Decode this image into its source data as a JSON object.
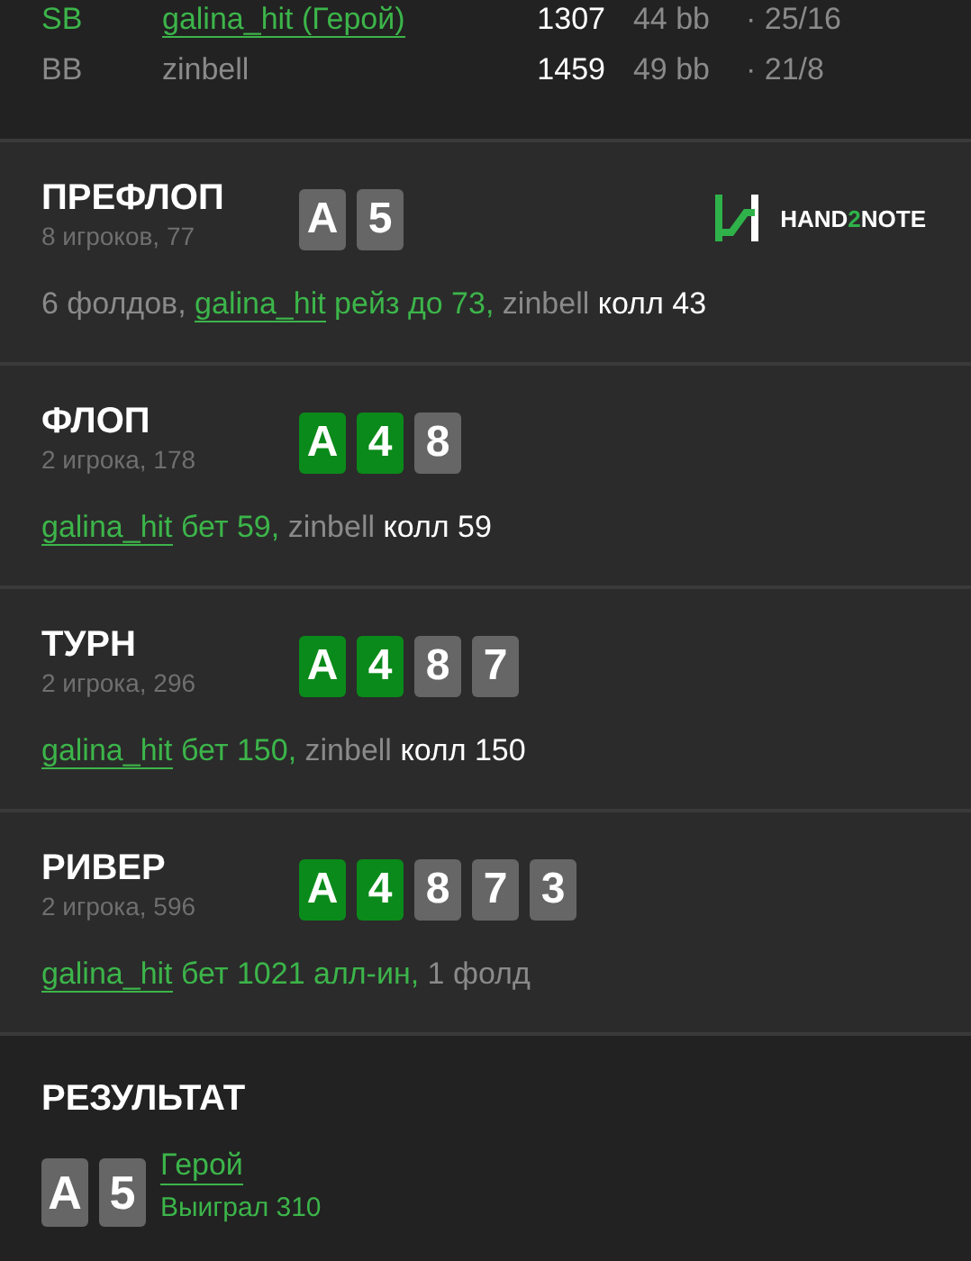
{
  "players": [
    {
      "position": "SB",
      "name": "galina_hit (Герой)",
      "hero": true,
      "stack": "1307",
      "bb": "44 bb",
      "stats": "· 25/16"
    },
    {
      "position": "BB",
      "name": "zinbell",
      "hero": false,
      "stack": "1459",
      "bb": "49 bb",
      "stats": "· 21/8"
    }
  ],
  "logo": {
    "parts": [
      {
        "text": "HAND",
        "kind": "plain"
      },
      {
        "text": "2",
        "kind": "accent"
      },
      {
        "text": "NOTE",
        "kind": "plain"
      }
    ]
  },
  "streets": [
    {
      "title": "ПРЕФЛОП",
      "subtitle": "8 игроков, 77",
      "logo": true,
      "cards": [
        {
          "rank": "A",
          "color": "#666666"
        },
        {
          "rank": "5",
          "color": "#666666"
        }
      ],
      "action": [
        {
          "text": "6 фолдов, ",
          "kind": "muted"
        },
        {
          "text": "galina_hit",
          "kind": "link"
        },
        {
          "text": " рейз до 73, ",
          "kind": "hero"
        },
        {
          "text": "zinbell ",
          "kind": "muted"
        },
        {
          "text": "колл 43",
          "kind": "strong"
        }
      ]
    },
    {
      "title": "ФЛОП",
      "subtitle": "2 игрока, 178",
      "logo": false,
      "cards": [
        {
          "rank": "A",
          "color": "#0a8a1a"
        },
        {
          "rank": "4",
          "color": "#0a8a1a"
        },
        {
          "rank": "8",
          "color": "#666666"
        }
      ],
      "action": [
        {
          "text": "galina_hit",
          "kind": "link"
        },
        {
          "text": " бет 59, ",
          "kind": "hero"
        },
        {
          "text": "zinbell ",
          "kind": "muted"
        },
        {
          "text": "колл 59",
          "kind": "strong"
        }
      ]
    },
    {
      "title": "ТУРН",
      "subtitle": "2 игрока, 296",
      "logo": false,
      "cards": [
        {
          "rank": "A",
          "color": "#0a8a1a"
        },
        {
          "rank": "4",
          "color": "#0a8a1a"
        },
        {
          "rank": "8",
          "color": "#666666"
        },
        {
          "rank": "7",
          "color": "#666666"
        }
      ],
      "action": [
        {
          "text": "galina_hit",
          "kind": "link"
        },
        {
          "text": " бет 150, ",
          "kind": "hero"
        },
        {
          "text": "zinbell ",
          "kind": "muted"
        },
        {
          "text": "колл 150",
          "kind": "strong"
        }
      ]
    },
    {
      "title": "РИВЕР",
      "subtitle": "2 игрока, 596",
      "logo": false,
      "cards": [
        {
          "rank": "A",
          "color": "#0a8a1a"
        },
        {
          "rank": "4",
          "color": "#0a8a1a"
        },
        {
          "rank": "8",
          "color": "#666666"
        },
        {
          "rank": "7",
          "color": "#666666"
        },
        {
          "rank": "3",
          "color": "#666666"
        }
      ],
      "action": [
        {
          "text": "galina_hit",
          "kind": "link"
        },
        {
          "text": " бет 1021 алл-ин, ",
          "kind": "hero"
        },
        {
          "text": "1 фолд",
          "kind": "muted"
        }
      ]
    }
  ],
  "result": {
    "title": "РЕЗУЛЬТАТ",
    "cards": [
      {
        "rank": "A",
        "color": "#666666"
      },
      {
        "rank": "5",
        "color": "#666666"
      }
    ],
    "player": "Герой",
    "outcome": "Выиграл 310"
  }
}
